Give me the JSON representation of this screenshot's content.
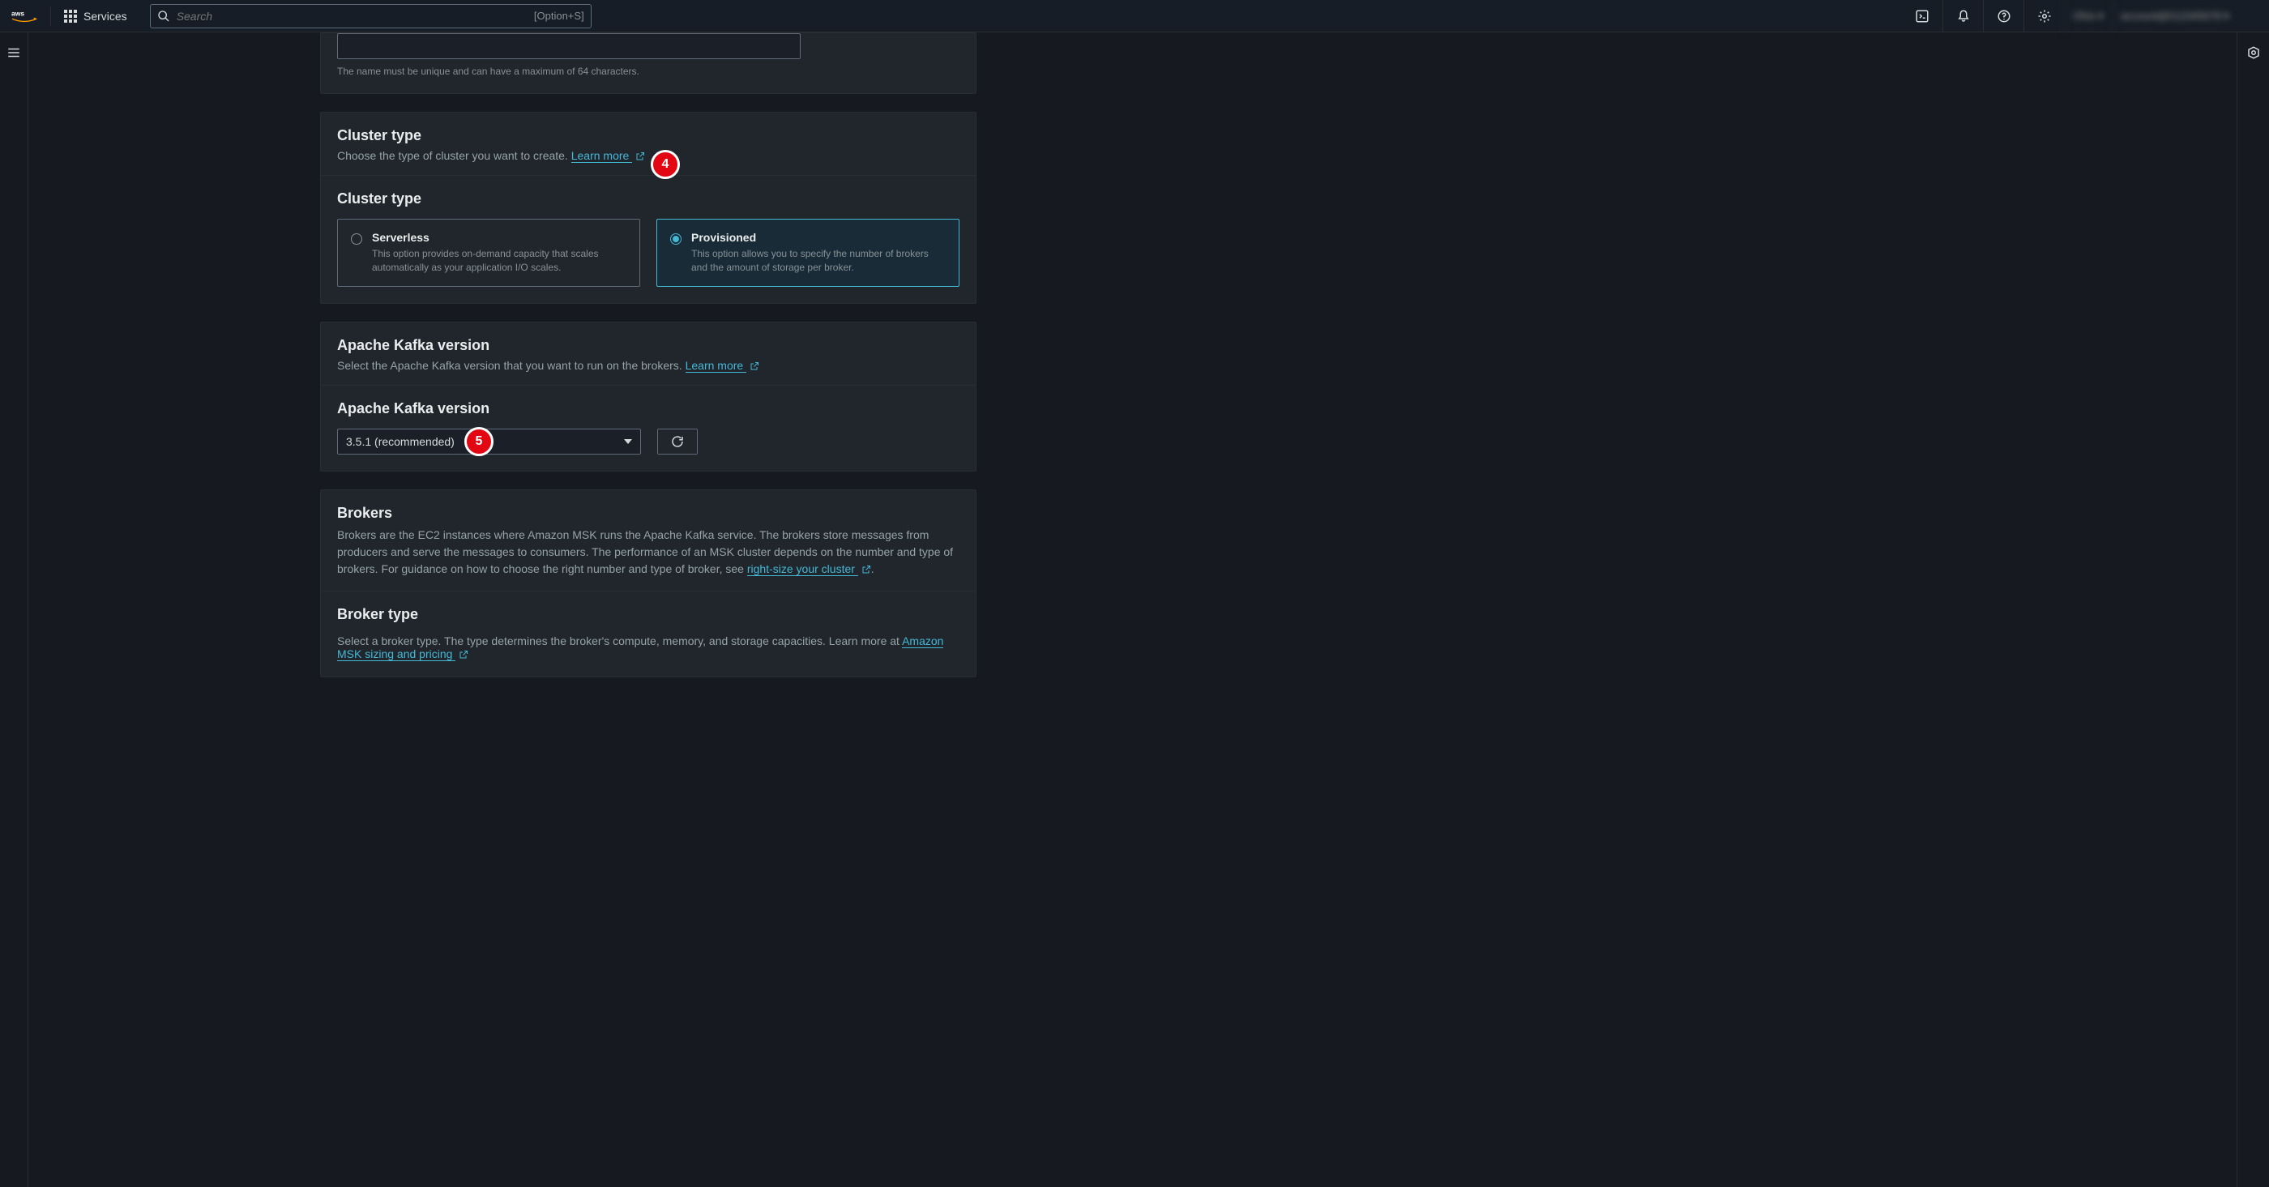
{
  "nav": {
    "services_label": "Services",
    "search_placeholder": "Search",
    "search_shortcut": "[Option+S]"
  },
  "name_section": {
    "hint": "The name must be unique and can have a maximum of 64 characters."
  },
  "cluster_type": {
    "heading": "Cluster type",
    "desc": "Choose the type of cluster you want to create. ",
    "learn_more": "Learn more ",
    "sub_heading": "Cluster type",
    "options": {
      "serverless": {
        "title": "Serverless",
        "desc": "This option provides on-demand capacity that scales automatically as your application I/O scales."
      },
      "provisioned": {
        "title": "Provisioned",
        "desc": "This option allows you to specify the number of brokers and the amount of storage per broker."
      }
    }
  },
  "kafka_version": {
    "heading": "Apache Kafka version",
    "desc": "Select the Apache Kafka version that you want to run on the brokers. ",
    "learn_more": "Learn more ",
    "sub_heading": "Apache Kafka version",
    "selected": "3.5.1 (recommended)"
  },
  "brokers": {
    "heading": "Brokers",
    "desc_pre": "Brokers are the EC2 instances where Amazon MSK runs the Apache Kafka service. The brokers store messages from producers and serve the messages to consumers. The performance of an MSK cluster depends on the number and type of brokers. For guidance on how to choose the right number and type of broker, see ",
    "link": "right-size your cluster ",
    "desc_post": ".",
    "broker_type_heading": "Broker type",
    "broker_type_desc_pre": "Select a broker type. The type determines the broker's compute, memory, and storage capacities. Learn more at ",
    "broker_type_link": "Amazon MSK sizing and pricing "
  },
  "annotations": {
    "a4": "4",
    "a5": "5"
  }
}
